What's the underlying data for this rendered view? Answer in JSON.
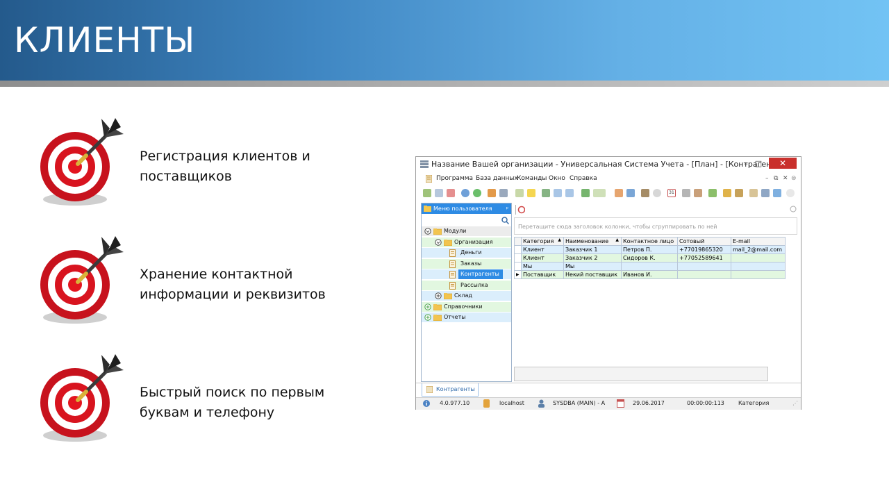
{
  "slide": {
    "title": "КЛИЕНТЫ",
    "features": [
      {
        "line1": "Регистрация клиентов и",
        "line2": "поставщиков"
      },
      {
        "line1": "Хранение контактной",
        "line2": "информации и реквизитов"
      },
      {
        "line1": "Быстрый поиск по первым",
        "line2": "буквам и телефону"
      }
    ]
  },
  "window": {
    "title": "Название Вашей организации - Универсальная Система Учета - [План] - [Контрагенты]",
    "minimize": "–",
    "maximize": "□",
    "close": "✕",
    "menu": [
      "Программа",
      "База данных",
      "Команды",
      "Окно",
      "Справка"
    ],
    "menu_controls": [
      "–",
      "⧉",
      "✕",
      "⊗"
    ],
    "sidebar": {
      "header": "Меню пользователя",
      "pin": "ᵖ",
      "tree": [
        {
          "label": "Модули",
          "level": 0,
          "icon": "collapse"
        },
        {
          "label": "Организация",
          "level": 1,
          "icon": "collapse"
        },
        {
          "label": "Деньги",
          "level": 2,
          "icon": "doc"
        },
        {
          "label": "Заказы",
          "level": 2,
          "icon": "doc"
        },
        {
          "label": "Контрагенты",
          "level": 2,
          "icon": "doc",
          "selected": true
        },
        {
          "label": "Рассылка",
          "level": 2,
          "icon": "doc"
        },
        {
          "label": "Склад",
          "level": 1,
          "icon": "expand"
        },
        {
          "label": "Справочники",
          "level": 0,
          "icon": "expand"
        },
        {
          "label": "Отчеты",
          "level": 0,
          "icon": "expand"
        }
      ]
    },
    "group_hint": "Перетащите сюда заголовок колонки, чтобы сгруппировать по ней",
    "grid": {
      "columns": [
        "Категория",
        "Наименование",
        "Контактное лицо",
        "Сотовый",
        "E-mail"
      ],
      "sort_columns": [
        0,
        1
      ],
      "rows": [
        [
          "Клиент",
          "Заказчик 1",
          "Петров П.",
          "+77019865320",
          "mail_2@mail.com"
        ],
        [
          "Клиент",
          "Заказчик 2",
          "Сидоров К.",
          "+77052589641",
          ""
        ],
        [
          "Мы",
          "Мы",
          "",
          "",
          ""
        ],
        [
          "Поставщик",
          "Некий поставщик",
          "Иванов И.",
          "",
          ""
        ]
      ],
      "current_row": 3
    },
    "tab": "Контрагенты",
    "status": {
      "version": "4.0.977.10",
      "server": "localhost",
      "user": "SYSDBA (MAIN) - A",
      "date": "29.06.2017",
      "time": "00:00:00:113",
      "field": "Категория",
      "calendar_day": "31"
    }
  },
  "colors": {
    "banner_start": "#245a8c",
    "banner_end": "#72c3f4",
    "selected_tree": "#2e8be4",
    "row_blue": "#dbeefc",
    "row_green": "#e2f7e0",
    "close_button": "#c9302c"
  }
}
